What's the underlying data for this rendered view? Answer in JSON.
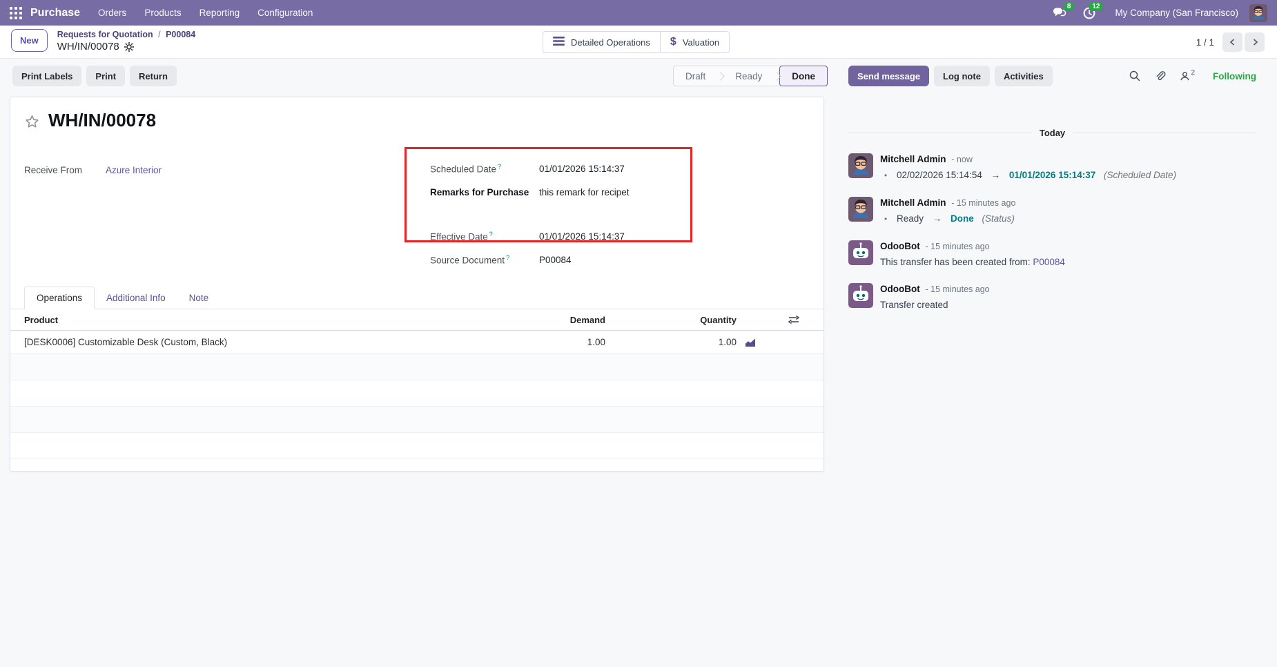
{
  "colors": {
    "navbar_bg": "#786CA5",
    "primary_button": "#71639E",
    "link_purple": "#5D52A3",
    "tracked_value_teal": "#017E84",
    "following_green": "#28A745",
    "badge_green": "#28A745",
    "highlight_box_red": "#E42527",
    "done_step_border": "#6F5C9E"
  },
  "navbar": {
    "app_name": "Purchase",
    "menus": [
      "Orders",
      "Products",
      "Reporting",
      "Configuration"
    ],
    "messages_badge": "8",
    "activities_badge": "12",
    "company_name": "My Company (San Francisco)"
  },
  "control_panel": {
    "new_button_label": "New",
    "breadcrumb_parent": "Requests for Quotation",
    "breadcrumb_separator": "/",
    "breadcrumb_ref": "P00084",
    "breadcrumb_current": "WH/IN/00078",
    "smart_buttons": [
      {
        "label": "Detailed Operations"
      },
      {
        "label": "Valuation",
        "icon_glyph": "$"
      }
    ],
    "pager_value": "1 / 1"
  },
  "form": {
    "action_buttons": [
      "Print Labels",
      "Print",
      "Return"
    ],
    "statusbar": {
      "steps": [
        "Draft",
        "Ready",
        "Done"
      ],
      "active_step": "Done"
    },
    "title": "WH/IN/00078",
    "fields": {
      "receive_from_label": "Receive From",
      "receive_from_value": "Azure Interior",
      "scheduled_date_label": "Scheduled Date",
      "scheduled_date_value": "01/01/2026 15:14:37",
      "remarks_label": "Remarks for Purchase",
      "remarks_value": "this remark for recipet",
      "effective_date_label": "Effective Date",
      "effective_date_value": "01/01/2026 15:14:37",
      "source_document_label": "Source Document",
      "source_document_value": "P00084",
      "help_marker": "?"
    },
    "tabs": [
      {
        "label": "Operations",
        "active": true
      },
      {
        "label": "Additional Info",
        "active": false
      },
      {
        "label": "Note",
        "active": false
      }
    ],
    "table": {
      "columns": [
        "Product",
        "Demand",
        "Quantity"
      ],
      "rows": [
        {
          "product": "[DESK0006] Customizable Desk (Custom, Black)",
          "demand": "1.00",
          "quantity": "1.00"
        }
      ]
    }
  },
  "chatter": {
    "buttons": [
      "Send message",
      "Log note",
      "Activities"
    ],
    "followers_count": "2",
    "following_label": "Following",
    "date_divider": "Today",
    "messages": [
      {
        "author": "Mitchell Admin",
        "time": "- now",
        "old": "02/02/2026 15:14:54",
        "arrow": "→",
        "new": "01/01/2026 15:14:37",
        "field": "(Scheduled Date)"
      },
      {
        "author": "Mitchell Admin",
        "time": "- 15 minutes ago",
        "old": "Ready",
        "arrow": "→",
        "new": "Done",
        "field": "(Status)"
      },
      {
        "author": "OdooBot",
        "time": "- 15 minutes ago",
        "body_prefix": "This transfer has been created from: ",
        "body_link": "P00084"
      },
      {
        "author": "OdooBot",
        "time": "- 15 minutes ago",
        "body_prefix": "Transfer created",
        "body_link": ""
      }
    ]
  }
}
